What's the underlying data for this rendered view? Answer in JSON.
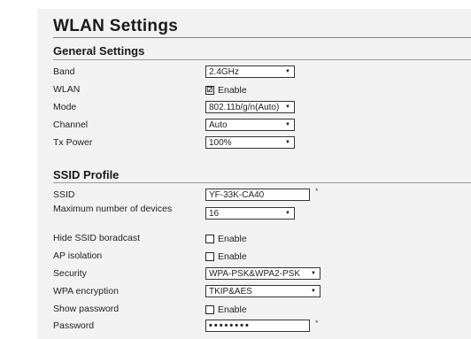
{
  "title": "WLAN Settings",
  "general": {
    "heading": "General Settings",
    "band": {
      "label": "Band",
      "value": "2.4GHz"
    },
    "wlan": {
      "label": "WLAN",
      "option": "Enable",
      "checked": true,
      "check_mark": "☑"
    },
    "mode": {
      "label": "Mode",
      "value": "802.11b/g/n(Auto)"
    },
    "channel": {
      "label": "Channel",
      "value": "Auto"
    },
    "tx_power": {
      "label": "Tx Power",
      "value": "100%"
    }
  },
  "ssid_profile": {
    "heading": "SSID Profile",
    "ssid": {
      "label": "SSID",
      "value": "YF-33K-CA40",
      "required_mark": "*"
    },
    "max_devices": {
      "label": "Maximum number of devices",
      "value": "16"
    },
    "hide_ssid": {
      "label": "Hide SSID boradcast",
      "option": "Enable",
      "checked": false
    },
    "ap_isolation": {
      "label": "AP isolation",
      "option": "Enable",
      "checked": false
    },
    "security": {
      "label": "Security",
      "value": "WPA-PSK&WPA2-PSK"
    },
    "wpa_encryption": {
      "label": "WPA encryption",
      "value": "TKIP&AES"
    },
    "show_password": {
      "label": "Show password",
      "option": "Enable",
      "checked": false
    },
    "password": {
      "label": "Password",
      "masked_value": "••••••••",
      "required_mark": "*"
    }
  },
  "icons": {
    "dropdown_arrow": "▼"
  }
}
